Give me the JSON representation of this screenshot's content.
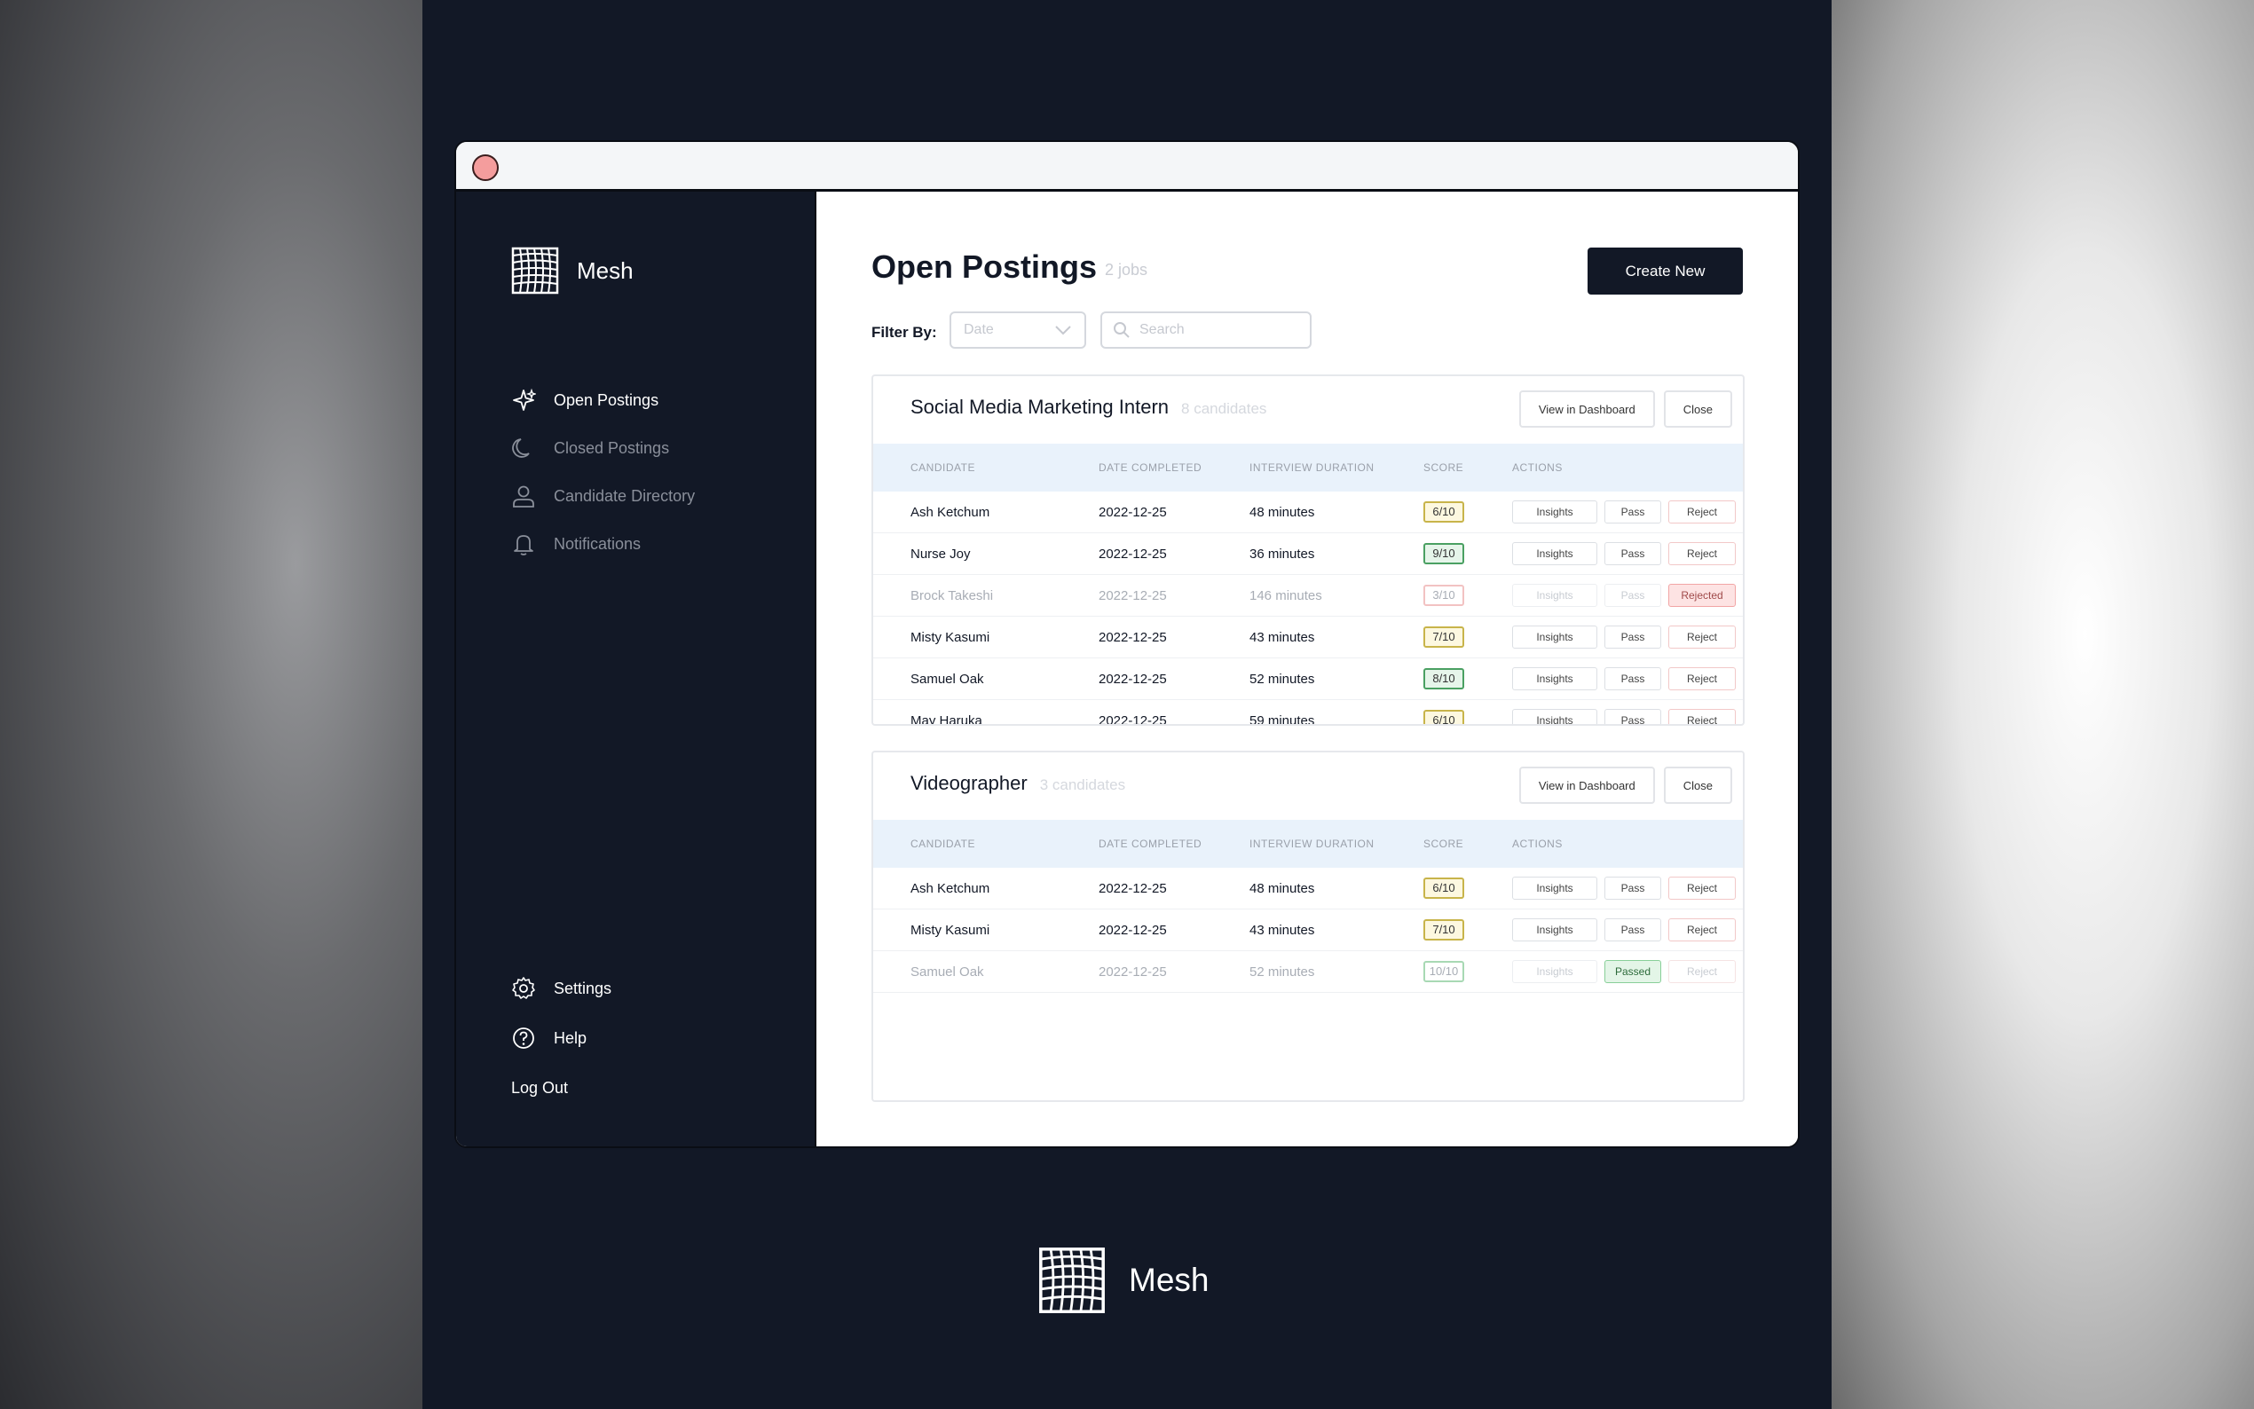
{
  "brand": {
    "name": "Mesh"
  },
  "sidebar": {
    "items": [
      {
        "label": "Open Postings"
      },
      {
        "label": "Closed Postings"
      },
      {
        "label": "Candidate Directory"
      },
      {
        "label": "Notifications"
      }
    ],
    "bottom": [
      {
        "label": "Settings"
      },
      {
        "label": "Help"
      },
      {
        "label": "Log Out"
      }
    ]
  },
  "main": {
    "title": "Open Postings",
    "count": "2 jobs",
    "create_label": "Create New",
    "filter_label": "Filter By:",
    "filter_select": "Date",
    "search_placeholder": "Search"
  },
  "table_headers": {
    "candidate": "CANDIDATE",
    "date": "DATE COMPLETED",
    "duration": "INTERVIEW DURATION",
    "score": "SCORE",
    "actions": "ACTIONS"
  },
  "actions": {
    "insights": "Insights",
    "pass": "Pass",
    "reject": "Reject",
    "rejected": "Rejected",
    "passed": "Passed",
    "view": "View in Dashboard",
    "close": "Close"
  },
  "postings": [
    {
      "title": "Social Media Marketing Intern",
      "count": "8 candidates",
      "rows": [
        {
          "name": "Ash Ketchum",
          "date": "2022-12-25",
          "duration": "48 minutes",
          "score": "6/10"
        },
        {
          "name": "Nurse Joy",
          "date": "2022-12-25",
          "duration": "36 minutes",
          "score": "9/10"
        },
        {
          "name": "Brock Takeshi",
          "date": "2022-12-25",
          "duration": "146 minutes",
          "score": "3/10"
        },
        {
          "name": "Misty Kasumi",
          "date": "2022-12-25",
          "duration": "43 minutes",
          "score": "7/10"
        },
        {
          "name": "Samuel Oak",
          "date": "2022-12-25",
          "duration": "52 minutes",
          "score": "8/10"
        },
        {
          "name": "May Haruka",
          "date": "2022-12-25",
          "duration": "59 minutes",
          "score": "6/10"
        }
      ]
    },
    {
      "title": "Videographer",
      "count": "3 candidates",
      "rows": [
        {
          "name": "Ash Ketchum",
          "date": "2022-12-25",
          "duration": "48 minutes",
          "score": "6/10"
        },
        {
          "name": "Misty Kasumi",
          "date": "2022-12-25",
          "duration": "43 minutes",
          "score": "7/10"
        },
        {
          "name": "Samuel Oak",
          "date": "2022-12-25",
          "duration": "52 minutes",
          "score": "10/10"
        }
      ]
    }
  ],
  "footer": {
    "name": "Mesh"
  }
}
